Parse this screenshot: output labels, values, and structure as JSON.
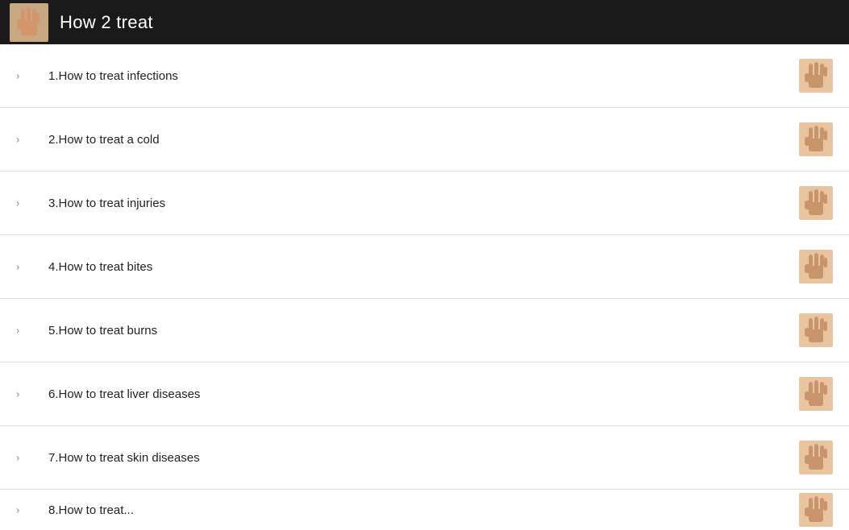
{
  "header": {
    "title": "How 2 treat",
    "logo_alt": "hand logo"
  },
  "list": {
    "items": [
      {
        "id": 1,
        "label": "1.How to treat infections"
      },
      {
        "id": 2,
        "label": "2.How to treat a cold"
      },
      {
        "id": 3,
        "label": "3.How to treat injuries"
      },
      {
        "id": 4,
        "label": "4.How to treat bites"
      },
      {
        "id": 5,
        "label": "5.How to treat burns"
      },
      {
        "id": 6,
        "label": "6.How to treat liver diseases"
      },
      {
        "id": 7,
        "label": "7.How to treat skin diseases"
      },
      {
        "id": 8,
        "label": "8.How to treat..."
      }
    ]
  }
}
